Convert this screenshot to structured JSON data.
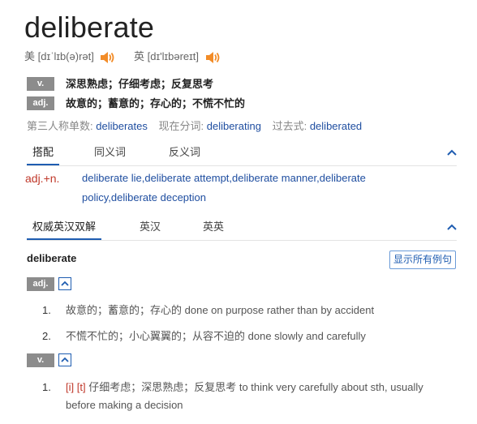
{
  "headword": "deliberate",
  "pronunciation": {
    "us_label": "美",
    "us_ipa": "[dɪˈlɪb(ə)rət]",
    "uk_label": "英",
    "uk_ipa": "[dɪ'lɪbəreɪt]",
    "speaker_icon": "speaker-icon",
    "speaker_color": "#f28c28"
  },
  "parts_of_speech": [
    {
      "tag": "v.",
      "definition": "深思熟虑；仔细考虑；反复思考"
    },
    {
      "tag": "adj.",
      "definition": "故意的；蓄意的；存心的；不慌不忙的"
    }
  ],
  "inflections": {
    "third_person_label": "第三人称单数:",
    "third_person": "deliberates",
    "present_participle_label": "现在分词:",
    "present_participle": "deliberating",
    "past_tense_label": "过去式:",
    "past_tense": "deliberated"
  },
  "tabs1": [
    "搭配",
    "同义词",
    "反义词"
  ],
  "collocations": {
    "pos": "adj.+n.",
    "items": [
      "deliberate lie",
      "deliberate attempt",
      "deliberate manner",
      "deliberate policy",
      "deliberate deception"
    ]
  },
  "tabs2": [
    "权威英汉双解",
    "英汉",
    "英英"
  ],
  "entry": {
    "word": "deliberate",
    "show_all_button": "显示所有例句",
    "adj_tag": "adj.",
    "adj_defs": [
      {
        "num": "1.",
        "cn": "故意的；蓄意的；存心的",
        "en": "done on purpose rather than by accident"
      },
      {
        "num": "2.",
        "cn": "不慌不忙的；小心翼翼的；从容不迫的",
        "en": "done slowly and carefully"
      }
    ],
    "v_tag": "v.",
    "v_defs": [
      {
        "num": "1.",
        "gram": "[i] [t]",
        "cn": "仔细考虑；深思熟虑；反复思考",
        "en": "to think very carefully about sth, usually before making a decision"
      }
    ]
  },
  "colors": {
    "link": "#1f4ea0",
    "accent": "#1f5db1",
    "pos_red": "#c0392b",
    "tag_gray": "#8c8c8c"
  }
}
